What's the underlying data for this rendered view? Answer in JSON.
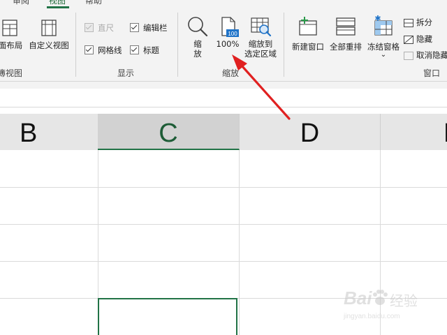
{
  "ribbon": {
    "tabs": [
      {
        "label": "审阅"
      },
      {
        "label": "视图",
        "active": true
      },
      {
        "label": "帮助"
      }
    ],
    "workbook_views": {
      "page_layout_label": "面布局",
      "custom_views_label": "自定义视图",
      "group_label": "簿视图"
    },
    "show": {
      "ruler_label": "直尺",
      "formula_bar_label": "编辑栏",
      "gridlines_label": "网格线",
      "headings_label": "标题",
      "ruler_checked": true,
      "ruler_disabled": true,
      "formula_bar_checked": true,
      "gridlines_checked": true,
      "headings_checked": true,
      "group_label": "显示"
    },
    "zoom": {
      "zoom_label_line1": "缩",
      "zoom_label_line2": "放",
      "hundred_label": "100%",
      "hundred_icon_text": "100",
      "selection_line1": "缩放到",
      "selection_line2": "选定区域",
      "group_label": "缩放"
    },
    "window": {
      "new_window_label": "新建窗口",
      "arrange_all_label": "全部重排",
      "freeze_panes_label": "冻结窗格",
      "split_label": "拆分",
      "hide_label": "隐藏",
      "unhide_label": "取消隐藏",
      "group_label": "窗口"
    }
  },
  "sheet": {
    "columns": [
      "B",
      "C",
      "D",
      "E"
    ],
    "selected_column": "C"
  },
  "watermark": {
    "brand": "Bai",
    "brand_suffix": "经验",
    "url": "jingyan.baidu.com"
  },
  "colors": {
    "accent": "#217346",
    "arrow": "#e02020"
  }
}
